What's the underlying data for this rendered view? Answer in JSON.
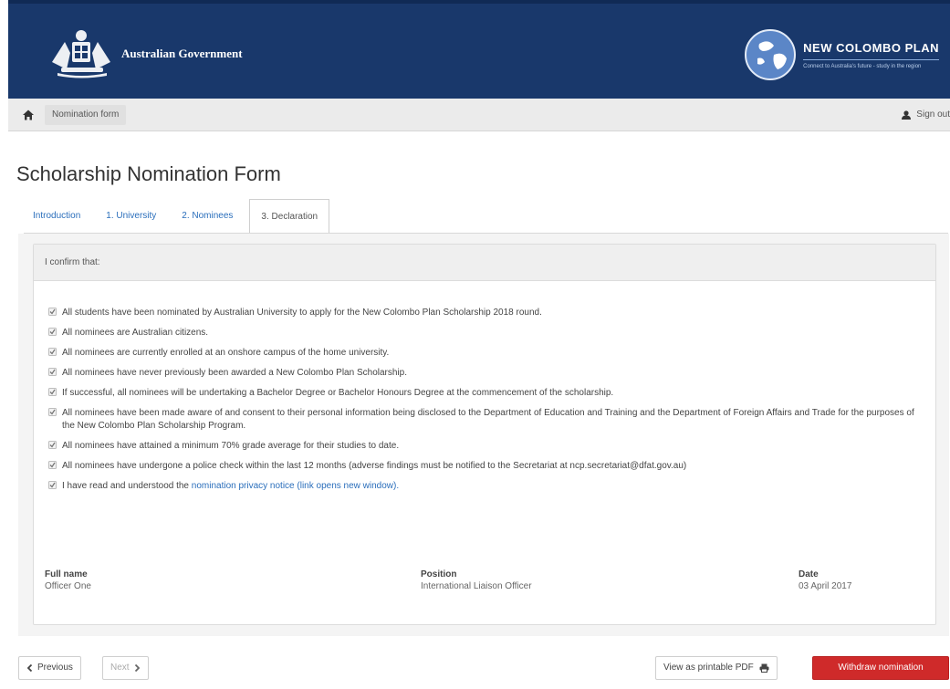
{
  "header": {
    "gov_name": "Australian Government",
    "program_title": "NEW COLOMBO PLAN",
    "program_tagline": "Connect to Australia's future - study in the region"
  },
  "topbar": {
    "breadcrumb": "Nomination form",
    "sign_out": "Sign out"
  },
  "page": {
    "title": "Scholarship Nomination Form"
  },
  "tabs": [
    {
      "label": "Introduction",
      "active": false
    },
    {
      "label": "1. University",
      "active": false
    },
    {
      "label": "2. Nominees",
      "active": false
    },
    {
      "label": "3. Declaration",
      "active": true
    }
  ],
  "declaration": {
    "heading": "I confirm that:",
    "items": [
      "All students have been nominated by Australian University to apply for the New Colombo Plan Scholarship 2018 round.",
      "All nominees are Australian citizens.",
      "All nominees are currently enrolled at an onshore campus of the home university.",
      "All nominees have never previously been awarded a New Colombo Plan Scholarship.",
      "If successful, all nominees will be undertaking a Bachelor Degree or Bachelor Honours Degree at the commencement of the scholarship.",
      "All nominees have been made aware of and consent to their personal information being disclosed to the Department of Education and Training and the Department of Foreign Affairs and Trade for the purposes of the New Colombo Plan Scholarship Program.",
      "All nominees have attained a minimum 70% grade average for their studies to date.",
      "All nominees have undergone a police check within the last 12 months (adverse findings must be notified to the Secretariat at ncp.secretariat@dfat.gov.au)"
    ],
    "privacy_prefix": "I have read and understood the",
    "privacy_link": "nomination privacy notice (link opens new window).",
    "checked": true
  },
  "signatory": {
    "full_name_label": "Full name",
    "full_name": "Officer One",
    "position_label": "Position",
    "position": "International Liaison Officer",
    "date_label": "Date",
    "date": "03 April 2017"
  },
  "footer": {
    "previous": "Previous",
    "next": "Next",
    "pdf": "View as printable PDF",
    "withdraw": "Withdraw nomination"
  },
  "colors": {
    "header_bg": "#19386b",
    "link": "#2a6ebb",
    "danger": "#cf2a2a"
  }
}
